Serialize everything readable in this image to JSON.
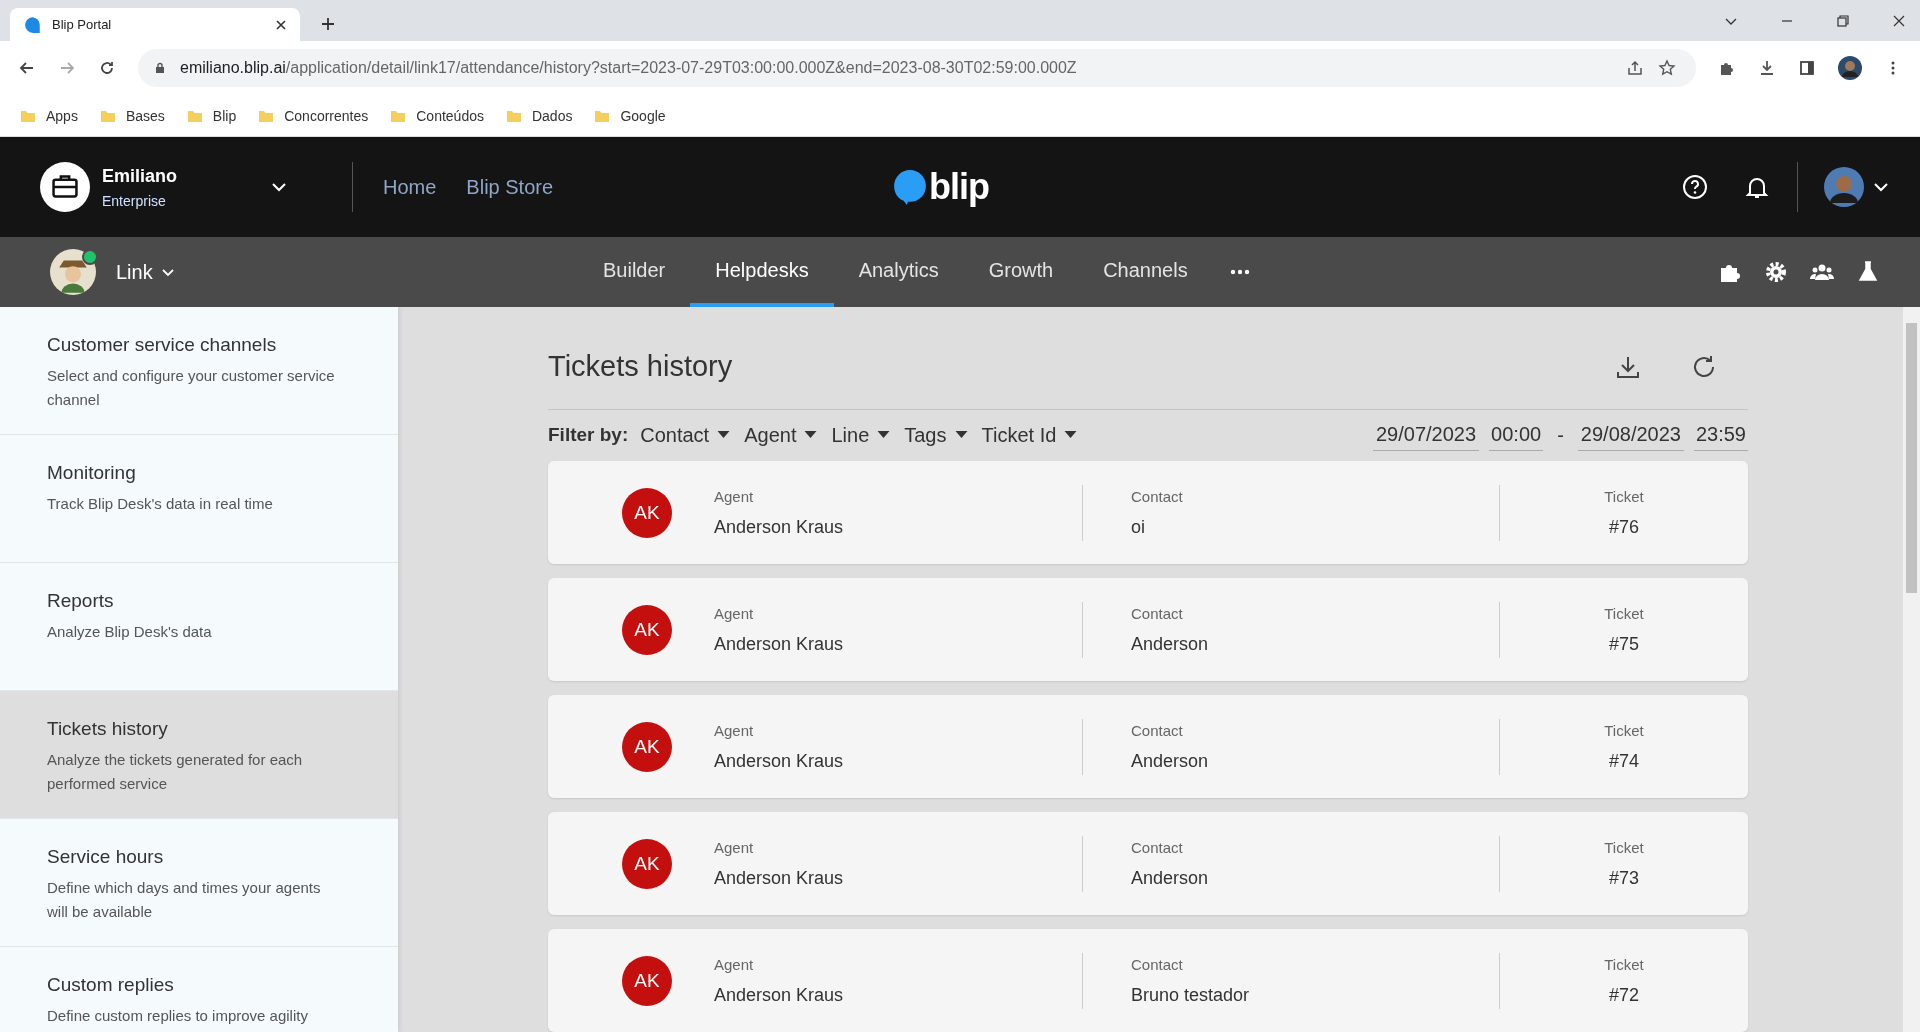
{
  "browser": {
    "tab_title": "Blip Portal",
    "url_host": "emiliano.blip.ai",
    "url_path": "/application/detail/link17/attendance/history?start=2023-07-29T03:00:00.000Z&end=2023-08-30T02:59:00.000Z",
    "bookmarks": [
      "Apps",
      "Bases",
      "Blip",
      "Concorrentes",
      "Conteúdos",
      "Dados",
      "Google"
    ]
  },
  "header": {
    "org_name": "Emiliano",
    "org_plan": "Enterprise",
    "links": [
      "Home",
      "Blip Store"
    ],
    "logo": "blip"
  },
  "subnav": {
    "bot_name": "Link",
    "bot_online": true,
    "tabs": [
      {
        "label": "Builder",
        "selected": false
      },
      {
        "label": "Helpdesks",
        "selected": true
      },
      {
        "label": "Analytics",
        "selected": false
      },
      {
        "label": "Growth",
        "selected": false
      },
      {
        "label": "Channels",
        "selected": false
      }
    ]
  },
  "sidebar": {
    "items": [
      {
        "title": "Customer service channels",
        "description": "Select and configure your customer service channel",
        "selected": false
      },
      {
        "title": "Monitoring",
        "description": "Track Blip Desk's data in real time",
        "selected": false
      },
      {
        "title": "Reports",
        "description": "Analyze Blip Desk's data",
        "selected": false
      },
      {
        "title": "Tickets history",
        "description": "Analyze the tickets generated for each performed service",
        "selected": true
      },
      {
        "title": "Service hours",
        "description": "Define which days and times your agents will be available",
        "selected": false
      },
      {
        "title": "Custom replies",
        "description": "Define custom replies to improve agility",
        "selected": false
      }
    ]
  },
  "page": {
    "title": "Tickets history",
    "filter_label": "Filter by:",
    "filters": [
      "Contact",
      "Agent",
      "Line",
      "Tags",
      "Ticket Id"
    ],
    "start_date": "29/07/2023",
    "start_time": "00:00",
    "separator": "-",
    "end_date": "29/08/2023",
    "end_time": "23:59"
  },
  "tickets": [
    {
      "initials": "AK",
      "agent_label": "Agent",
      "agent": "Anderson Kraus",
      "contact_label": "Contact",
      "contact": "oi",
      "ticket_label": "Ticket",
      "ticket": "#76"
    },
    {
      "initials": "AK",
      "agent_label": "Agent",
      "agent": "Anderson Kraus",
      "contact_label": "Contact",
      "contact": "Anderson",
      "ticket_label": "Ticket",
      "ticket": "#75"
    },
    {
      "initials": "AK",
      "agent_label": "Agent",
      "agent": "Anderson Kraus",
      "contact_label": "Contact",
      "contact": "Anderson",
      "ticket_label": "Ticket",
      "ticket": "#74"
    },
    {
      "initials": "AK",
      "agent_label": "Agent",
      "agent": "Anderson Kraus",
      "contact_label": "Contact",
      "contact": "Anderson",
      "ticket_label": "Ticket",
      "ticket": "#73"
    },
    {
      "initials": "AK",
      "agent_label": "Agent",
      "agent": "Anderson Kraus",
      "contact_label": "Contact",
      "contact": "Bruno testador",
      "ticket_label": "Ticket",
      "ticket": "#72"
    }
  ]
}
